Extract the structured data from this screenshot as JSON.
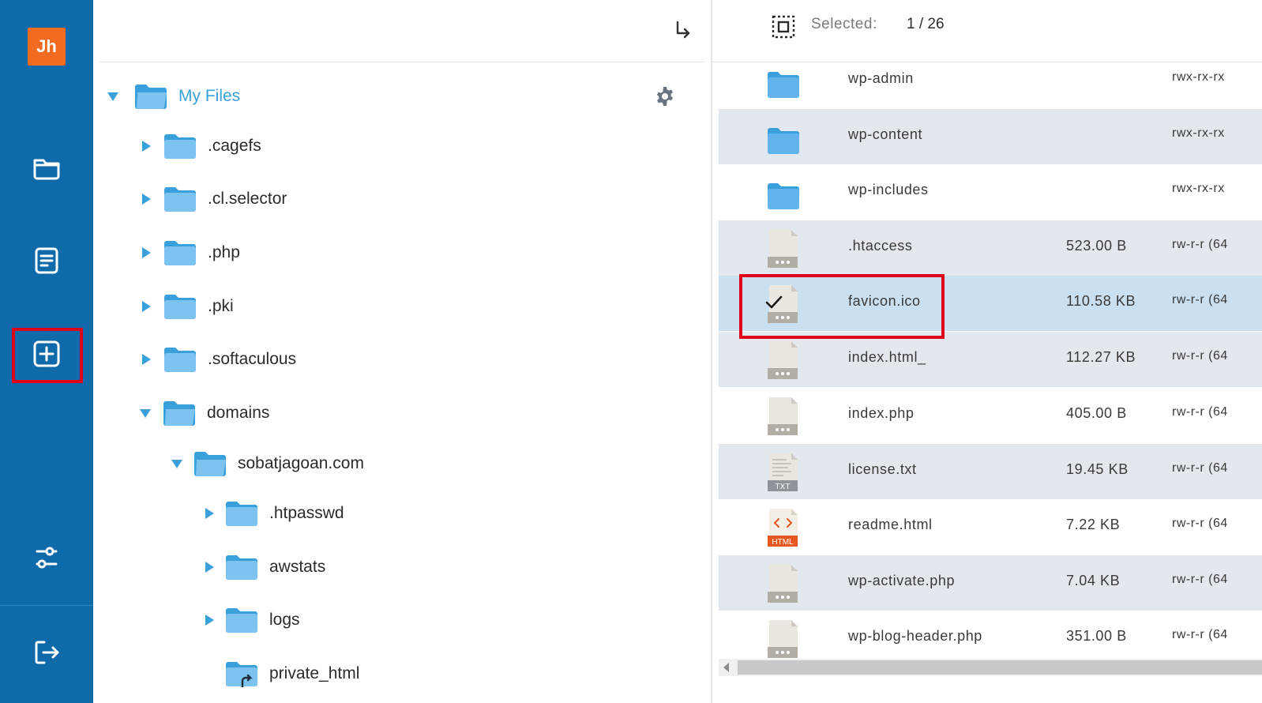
{
  "sidebar": {
    "logo_text": "Jh",
    "items": [
      {
        "name": "folder-icon"
      },
      {
        "name": "document-icon"
      },
      {
        "name": "add-square-icon"
      },
      {
        "name": "settings-sliders-icon"
      },
      {
        "name": "logout-icon"
      }
    ]
  },
  "tree": {
    "root_label": "My Files",
    "items": [
      {
        "label": ".cagefs"
      },
      {
        "label": ".cl.selector"
      },
      {
        "label": ".php"
      },
      {
        "label": ".pki"
      },
      {
        "label": ".softaculous"
      },
      {
        "label": "domains"
      },
      {
        "label": "sobatjagoan.com"
      },
      {
        "label": ".htpasswd"
      },
      {
        "label": "awstats"
      },
      {
        "label": "logs"
      },
      {
        "label": "private_html"
      }
    ]
  },
  "list": {
    "selected_label": "Selected:",
    "selected_count": "1 / 26",
    "files": [
      {
        "name": "wp-admin",
        "size": "",
        "perm": "rwx-rx-rx",
        "icon": "folder-icon"
      },
      {
        "name": "wp-content",
        "size": "",
        "perm": "rwx-rx-rx",
        "icon": "folder-icon"
      },
      {
        "name": "wp-includes",
        "size": "",
        "perm": "rwx-rx-rx",
        "icon": "folder-icon"
      },
      {
        "name": ".htaccess",
        "size": "523.00 B",
        "perm": "rw-r-r (64",
        "icon": "file-icon"
      },
      {
        "name": "favicon.ico",
        "size": "110.58 KB",
        "perm": "rw-r-r (64",
        "icon": "file-icon"
      },
      {
        "name": "index.html_",
        "size": "112.27 KB",
        "perm": "rw-r-r (64",
        "icon": "file-icon"
      },
      {
        "name": "index.php",
        "size": "405.00 B",
        "perm": "rw-r-r (64",
        "icon": "file-icon"
      },
      {
        "name": "license.txt",
        "size": "19.45 KB",
        "perm": "rw-r-r (64",
        "icon": "txt-file-icon",
        "badge": "TXT"
      },
      {
        "name": "readme.html",
        "size": "7.22 KB",
        "perm": "rw-r-r (64",
        "icon": "html-file-icon",
        "badge": "HTML"
      },
      {
        "name": "wp-activate.php",
        "size": "7.04 KB",
        "perm": "rw-r-r (64",
        "icon": "file-icon"
      },
      {
        "name": "wp-blog-header.php",
        "size": "351.00 B",
        "perm": "rw-r-r (64",
        "icon": "file-icon"
      }
    ]
  },
  "colors": {
    "sidebar": "#0e6aa8",
    "accent": "#3aa0dc",
    "highlight": "#e0001b",
    "selected_row": "#cadff0",
    "alt_row": "#e3e8ee"
  }
}
